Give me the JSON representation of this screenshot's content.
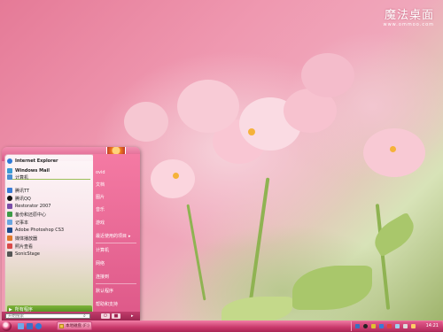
{
  "brand": {
    "title": "魔法桌面",
    "url": "www.ommoo.com"
  },
  "start_menu": {
    "pinned": [
      {
        "label": "Internet Explorer",
        "icon": "ie-icon",
        "color": "#2f7ad8"
      },
      {
        "label": "Windows Mail",
        "icon": "mail-icon",
        "color": "#3b9bd6"
      }
    ],
    "recent": [
      {
        "label": "计算机",
        "icon": "computer-icon",
        "color": "#4a8fd0"
      },
      {
        "label": "腾讯TT",
        "icon": "tt-icon",
        "color": "#3a7bd5"
      },
      {
        "label": "腾讯QQ",
        "icon": "qq-icon",
        "color": "#111111"
      },
      {
        "label": "Restorator 2007",
        "icon": "restorator-icon",
        "color": "#7a4ea8"
      },
      {
        "label": "备份和还原中心",
        "icon": "backup-icon",
        "color": "#3d9b46"
      },
      {
        "label": "记事本",
        "icon": "notepad-icon",
        "color": "#6aa6e0"
      },
      {
        "label": "Adobe Photoshop CS3",
        "icon": "photoshop-icon",
        "color": "#1c4a8c"
      },
      {
        "label": "媒体播放器",
        "icon": "media-player-icon",
        "color": "#e0782a"
      },
      {
        "label": "照片查看",
        "icon": "photo-viewer-icon",
        "color": "#d94a4a"
      },
      {
        "label": "SonicStage",
        "icon": "sonicstage-icon",
        "color": "#555555"
      }
    ],
    "all_programs": "所有程序",
    "search_placeholder": "开始搜索",
    "places": [
      "ovid",
      "文档",
      "图片",
      "音乐",
      "游戏",
      "最近使用的项目",
      "计算机",
      "网络",
      "连接到",
      "默认程序",
      "帮助和支持"
    ]
  },
  "taskbar": {
    "window_label": "本地磁盘 (F:)",
    "clock": "14:21"
  }
}
